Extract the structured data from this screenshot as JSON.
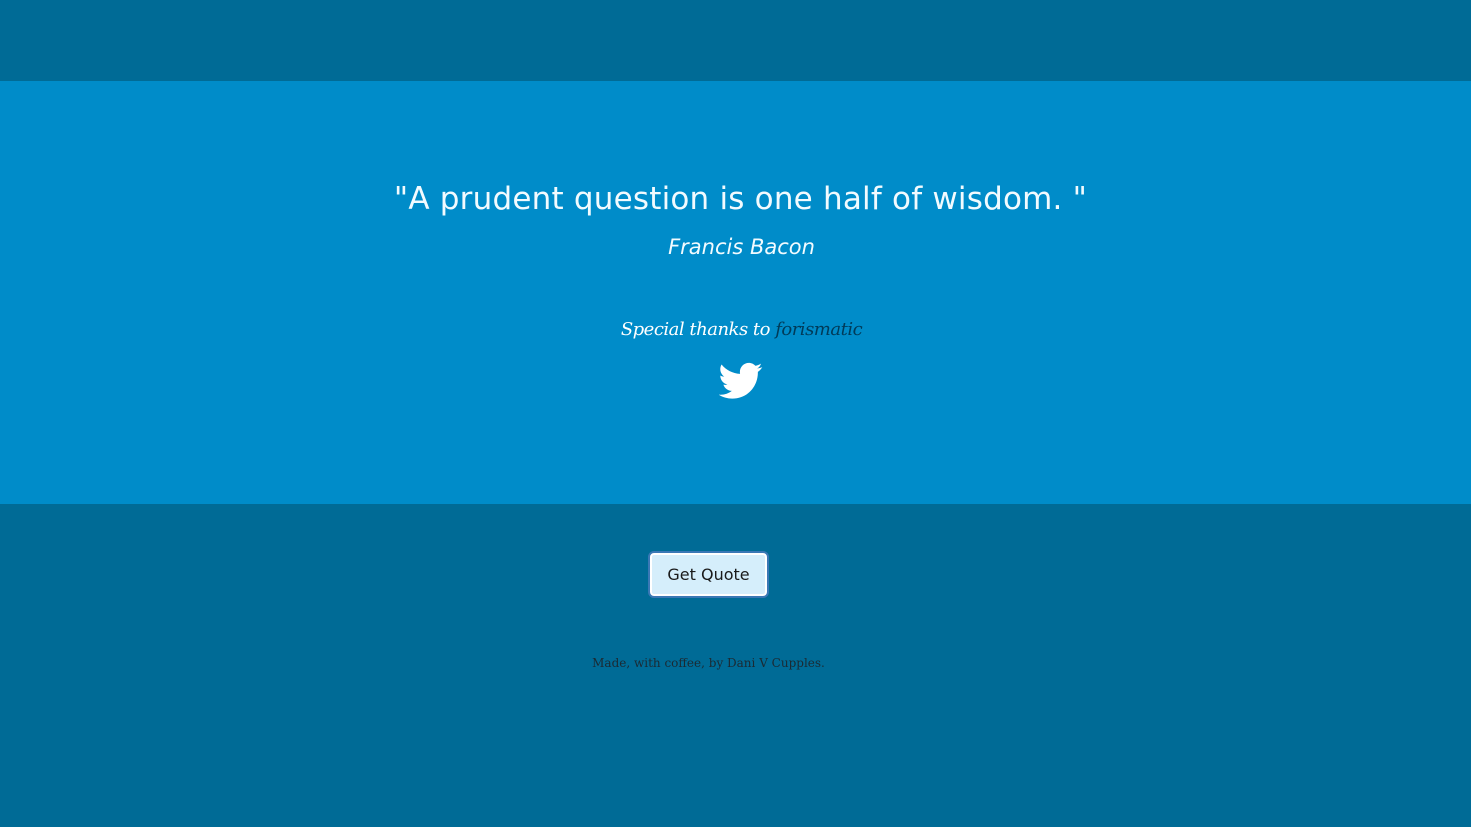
{
  "quote": {
    "text": "\"A prudent question is one half of wisdom. \"",
    "author": "Francis Bacon"
  },
  "thanks": {
    "prefix": "Special thanks to ",
    "link_text": "forismatic"
  },
  "tweet": {
    "icon": "twitter-bird-icon"
  },
  "controls": {
    "get_quote_label": "Get Quote"
  },
  "footer": {
    "credits": "Made, with coffee, by Dani V Cupples."
  },
  "colors": {
    "header_bg": "#006b96",
    "quote_panel_bg": "#008cc9",
    "page_bg": "#006b96",
    "button_bg": "#d5eefb"
  }
}
